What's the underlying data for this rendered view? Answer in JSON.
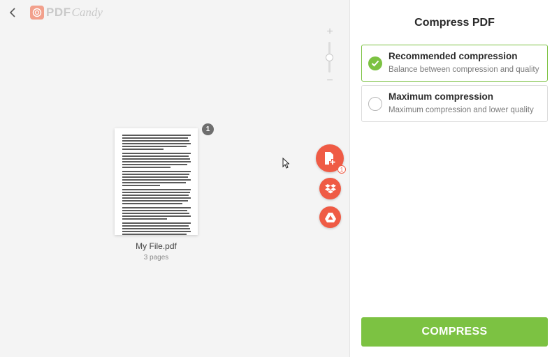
{
  "brand": {
    "name_pdf": "PDF",
    "name_candy": "Candy"
  },
  "zoom": {
    "plus": "+",
    "minus": "−",
    "level": 0.6
  },
  "file": {
    "name": "My File.pdf",
    "pages_label": "3 pages",
    "page_number": "1"
  },
  "upload": {
    "pending_count": "1"
  },
  "icons": {
    "back": "chevron-left-icon",
    "logo": "pdfcandy-logo",
    "add_file": "add-file-icon",
    "dropbox": "dropbox-icon",
    "drive": "google-drive-icon",
    "selected": "check-icon",
    "cursor": "mouse-cursor-icon"
  },
  "panel": {
    "title": "Compress PDF",
    "options": [
      {
        "title": "Recommended compression",
        "subtitle": "Balance between compression and quality",
        "selected": true
      },
      {
        "title": "Maximum compression",
        "subtitle": "Maximum compression and lower quality",
        "selected": false
      }
    ],
    "action_label": "COMPRESS"
  },
  "colors": {
    "accent_green": "#7cc242",
    "fab_red": "#ef5b45",
    "workspace_bg": "#f4f4f4"
  }
}
